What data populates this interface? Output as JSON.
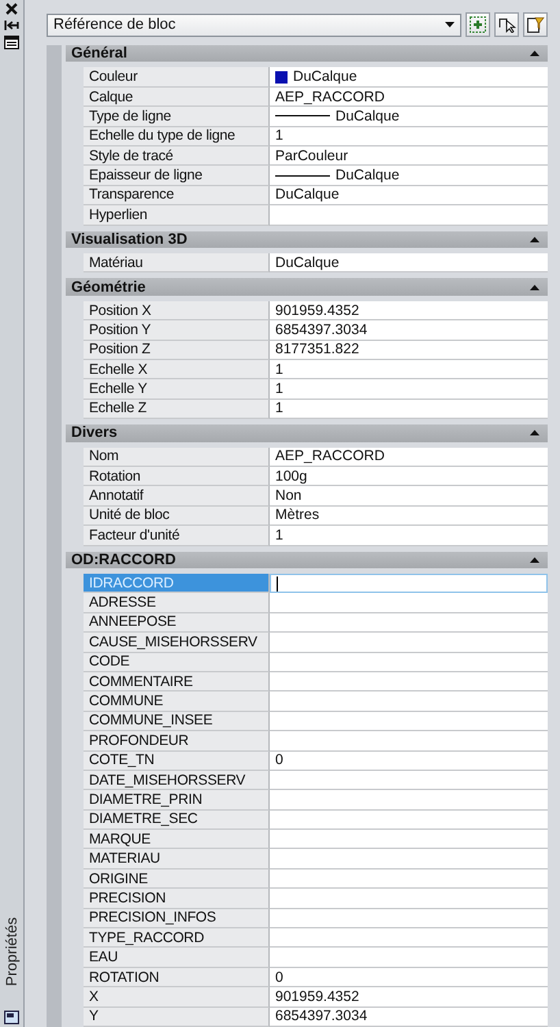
{
  "palette": {
    "title": "Propriétés"
  },
  "selector": {
    "value": "Référence de bloc"
  },
  "sections": [
    {
      "title": "Général",
      "expanded": true,
      "rows": [
        {
          "label": "Couleur",
          "value": "DuCalque",
          "kind": "color",
          "color": "#0a10b0",
          "selected": false
        },
        {
          "label": "Calque",
          "value": "AEP_RACCORD",
          "kind": "text",
          "selected": false
        },
        {
          "label": "Type de ligne",
          "value": "DuCalque",
          "kind": "line",
          "selected": false
        },
        {
          "label": "Echelle du type de ligne",
          "value": "1",
          "kind": "text",
          "selected": false
        },
        {
          "label": "Style de tracé",
          "value": "ParCouleur",
          "kind": "text",
          "selected": false
        },
        {
          "label": "Epaisseur de ligne",
          "value": "DuCalque",
          "kind": "line",
          "selected": false
        },
        {
          "label": "Transparence",
          "value": "DuCalque",
          "kind": "text",
          "selected": false
        },
        {
          "label": "Hyperlien",
          "kind": "text",
          "selected": false
        }
      ]
    },
    {
      "title": "Visualisation 3D",
      "expanded": true,
      "rows": [
        {
          "label": "Matériau",
          "value": "DuCalque",
          "kind": "text",
          "selected": false
        }
      ]
    },
    {
      "title": "Géométrie",
      "expanded": true,
      "rows": [
        {
          "label": "Position X",
          "value": "901959.4352",
          "kind": "text",
          "selected": false
        },
        {
          "label": "Position Y",
          "value": "6854397.3034",
          "kind": "text",
          "selected": false
        },
        {
          "label": "Position Z",
          "value": "8177351.822",
          "kind": "text",
          "selected": false
        },
        {
          "label": "Echelle X",
          "value": "1",
          "kind": "text",
          "selected": false
        },
        {
          "label": "Echelle Y",
          "value": "1",
          "kind": "text",
          "selected": false
        },
        {
          "label": "Echelle Z",
          "value": "1",
          "kind": "text",
          "selected": false
        }
      ]
    },
    {
      "title": "Divers",
      "expanded": true,
      "rows": [
        {
          "label": "Nom",
          "value": "AEP_RACCORD",
          "kind": "text",
          "selected": false
        },
        {
          "label": "Rotation",
          "value": "100g",
          "kind": "text",
          "selected": false
        },
        {
          "label": "Annotatif",
          "value": "Non",
          "kind": "text",
          "selected": false
        },
        {
          "label": "Unité de bloc",
          "value": "Mètres",
          "kind": "text",
          "selected": false
        },
        {
          "label": "Facteur d'unité",
          "value": "1",
          "kind": "text",
          "selected": false
        }
      ]
    },
    {
      "title": "OD:RACCORD",
      "expanded": true,
      "rows": [
        {
          "label": "IDRACCORD",
          "kind": "text",
          "selected": true
        },
        {
          "label": "ADRESSE",
          "kind": "text",
          "selected": false
        },
        {
          "label": "ANNEEPOSE",
          "kind": "text",
          "selected": false
        },
        {
          "label": "CAUSE_MISEHORSSERV",
          "kind": "text",
          "selected": false
        },
        {
          "label": "CODE",
          "kind": "text",
          "selected": false
        },
        {
          "label": "COMMENTAIRE",
          "kind": "text",
          "selected": false
        },
        {
          "label": "COMMUNE",
          "kind": "text",
          "selected": false
        },
        {
          "label": "COMMUNE_INSEE",
          "kind": "text",
          "selected": false
        },
        {
          "label": "PROFONDEUR",
          "kind": "text",
          "selected": false
        },
        {
          "label": "COTE_TN",
          "value": "0",
          "kind": "text",
          "selected": false
        },
        {
          "label": "DATE_MISEHORSSERV",
          "kind": "text",
          "selected": false
        },
        {
          "label": "DIAMETRE_PRIN",
          "kind": "text",
          "selected": false
        },
        {
          "label": "DIAMETRE_SEC",
          "kind": "text",
          "selected": false
        },
        {
          "label": "MARQUE",
          "kind": "text",
          "selected": false
        },
        {
          "label": "MATERIAU",
          "kind": "text",
          "selected": false
        },
        {
          "label": "ORIGINE",
          "kind": "text",
          "selected": false
        },
        {
          "label": "PRECISION",
          "kind": "text",
          "selected": false
        },
        {
          "label": "PRECISION_INFOS",
          "kind": "text",
          "selected": false
        },
        {
          "label": "TYPE_RACCORD",
          "kind": "text",
          "selected": false
        },
        {
          "label": "EAU",
          "kind": "text",
          "selected": false
        },
        {
          "label": "ROTATION",
          "value": "0",
          "kind": "text",
          "selected": false
        },
        {
          "label": "X",
          "value": "901959.4352",
          "kind": "text",
          "selected": false
        },
        {
          "label": "Y",
          "value": "6854397.3034",
          "kind": "text",
          "selected": false
        }
      ]
    }
  ]
}
